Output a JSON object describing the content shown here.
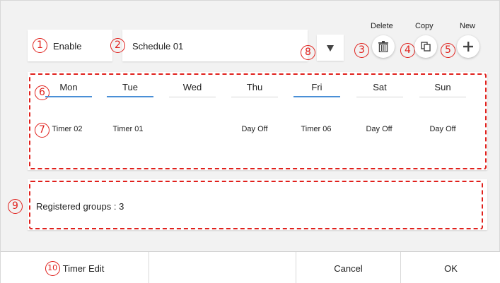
{
  "header": {
    "enable_label": "Enable",
    "schedule_name": "Schedule 01",
    "delete_label": "Delete",
    "copy_label": "Copy",
    "new_label": "New"
  },
  "days": [
    {
      "label": "Mon",
      "value": "Timer 02",
      "active": true
    },
    {
      "label": "Tue",
      "value": "Timer 01",
      "active": true
    },
    {
      "label": "Wed",
      "value": "",
      "active": false
    },
    {
      "label": "Thu",
      "value": "Day Off",
      "active": false
    },
    {
      "label": "Fri",
      "value": "Timer 06",
      "active": true
    },
    {
      "label": "Sat",
      "value": "Day Off",
      "active": false
    },
    {
      "label": "Sun",
      "value": "Day Off",
      "active": false
    }
  ],
  "groups": {
    "label": "Registered groups : 3"
  },
  "footer": {
    "timer_edit": "Timer Edit",
    "cancel": "Cancel",
    "ok": "OK"
  },
  "annotations": {
    "n1": "1",
    "n2": "2",
    "n3": "3",
    "n4": "4",
    "n5": "5",
    "n6": "6",
    "n7": "7",
    "n8": "8",
    "n9": "9",
    "n10": "10"
  },
  "colors": {
    "annotation": "#e0201c",
    "active_tab": "#4a8fd6",
    "background": "#f2f2f2"
  }
}
